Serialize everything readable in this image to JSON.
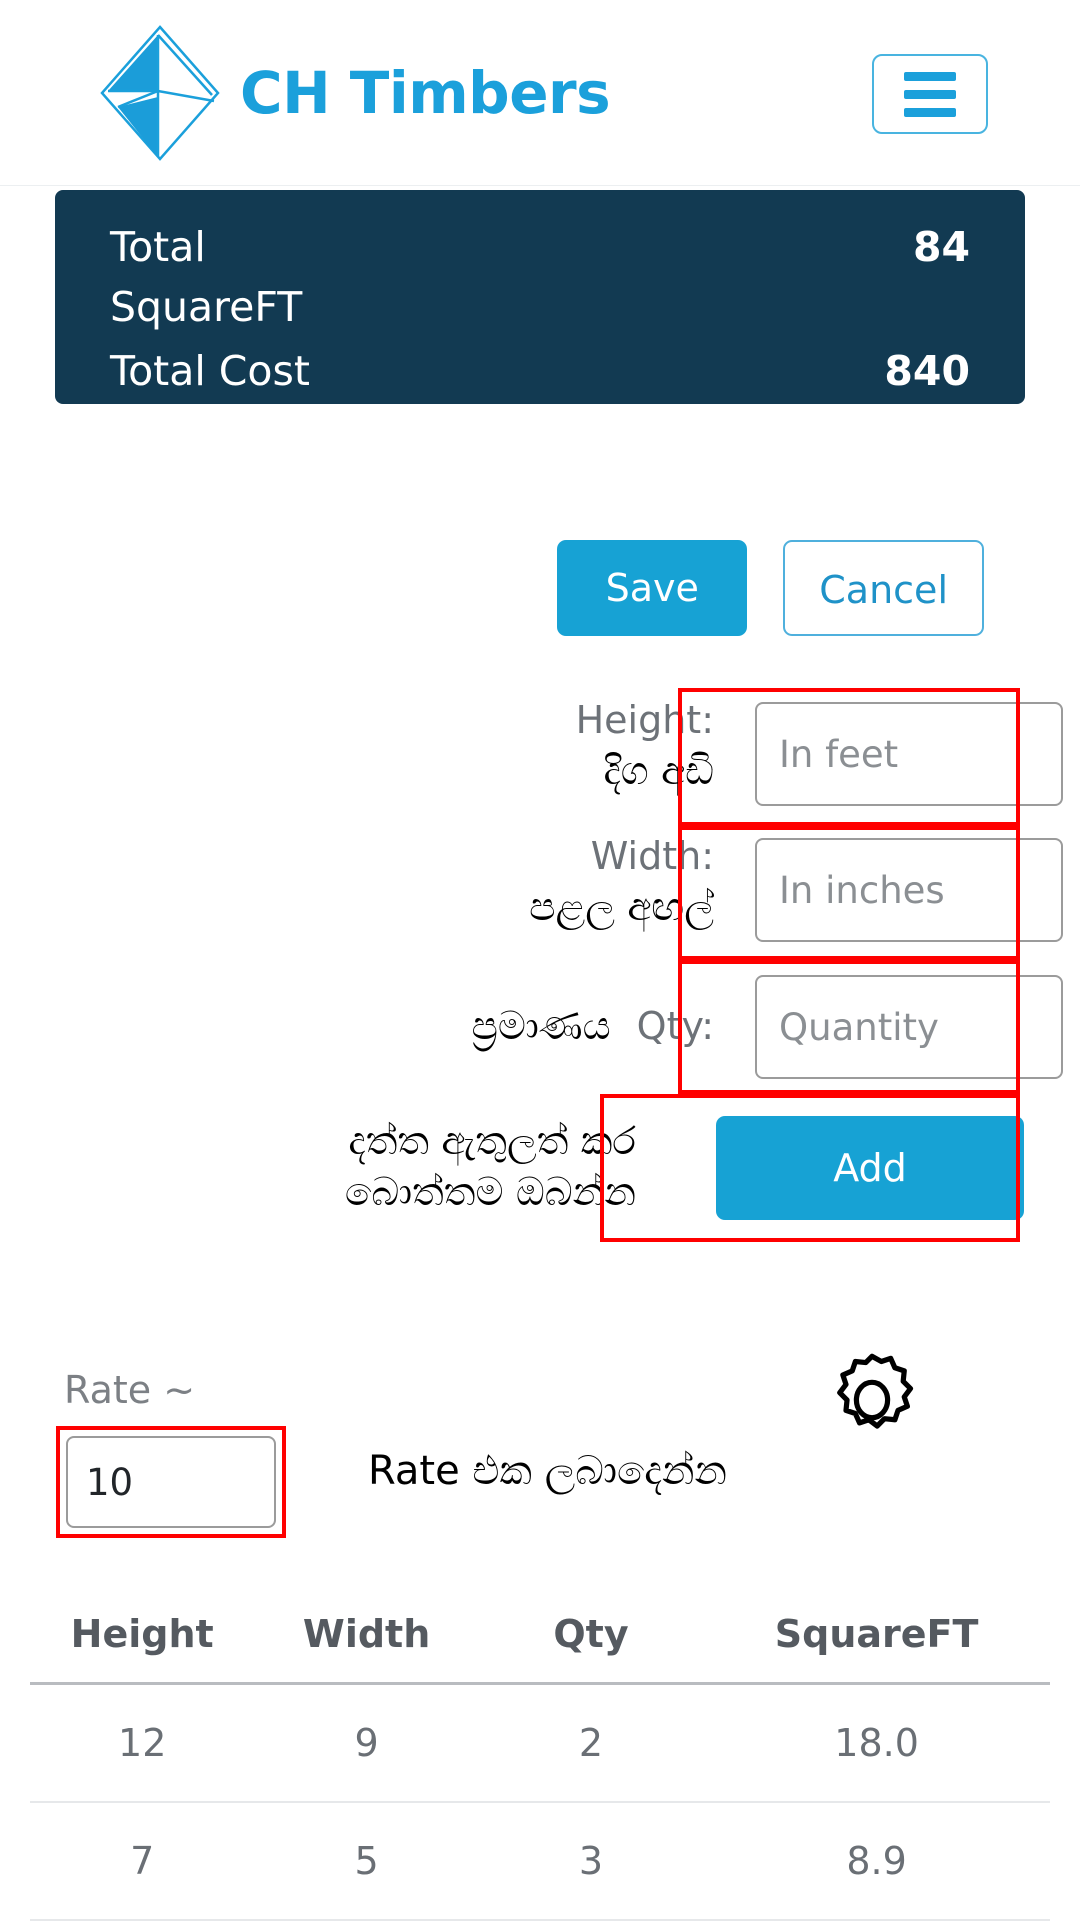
{
  "header": {
    "brand": "CH Timbers",
    "logo_icon": "diamond-octahedron-logo",
    "menu_icon": "hamburger-menu-icon",
    "brand_color": "#1ba0db"
  },
  "summary": {
    "total_sqft_label": "Total\nSquareFT",
    "total_sqft_value": "84",
    "total_cost_label": "Total Cost",
    "total_cost_value": "840",
    "bg_color": "#123a52"
  },
  "actions": {
    "save_label": "Save",
    "cancel_label": "Cancel",
    "save_color": "#17a2d4"
  },
  "form": {
    "height": {
      "label": "Height:",
      "label_si": "දිග අඩි",
      "placeholder": "In feet",
      "value": ""
    },
    "width": {
      "label": "Width:",
      "label_si": "පළල අඟල්",
      "placeholder": "In inches",
      "value": ""
    },
    "qty": {
      "label": "Qty:",
      "label_si": "ප්‍රමාණය",
      "placeholder": "Quantity",
      "value": ""
    },
    "add": {
      "label": "Add",
      "hint_si": "දත්ත ඇතුලත් කර\nබොත්තම ඔබන්න"
    },
    "highlight_color": "#ff0000"
  },
  "rate": {
    "caption": "Rate ~",
    "value": "10",
    "hint": "Rate එක ලබාදෙන්න",
    "settings_icon": "gear-icon"
  },
  "table": {
    "columns": [
      "Height",
      "Width",
      "Qty",
      "SquareFT"
    ],
    "rows": [
      [
        "12",
        "9",
        "2",
        "18.0"
      ],
      [
        "7",
        "5",
        "3",
        "8.9"
      ]
    ]
  }
}
